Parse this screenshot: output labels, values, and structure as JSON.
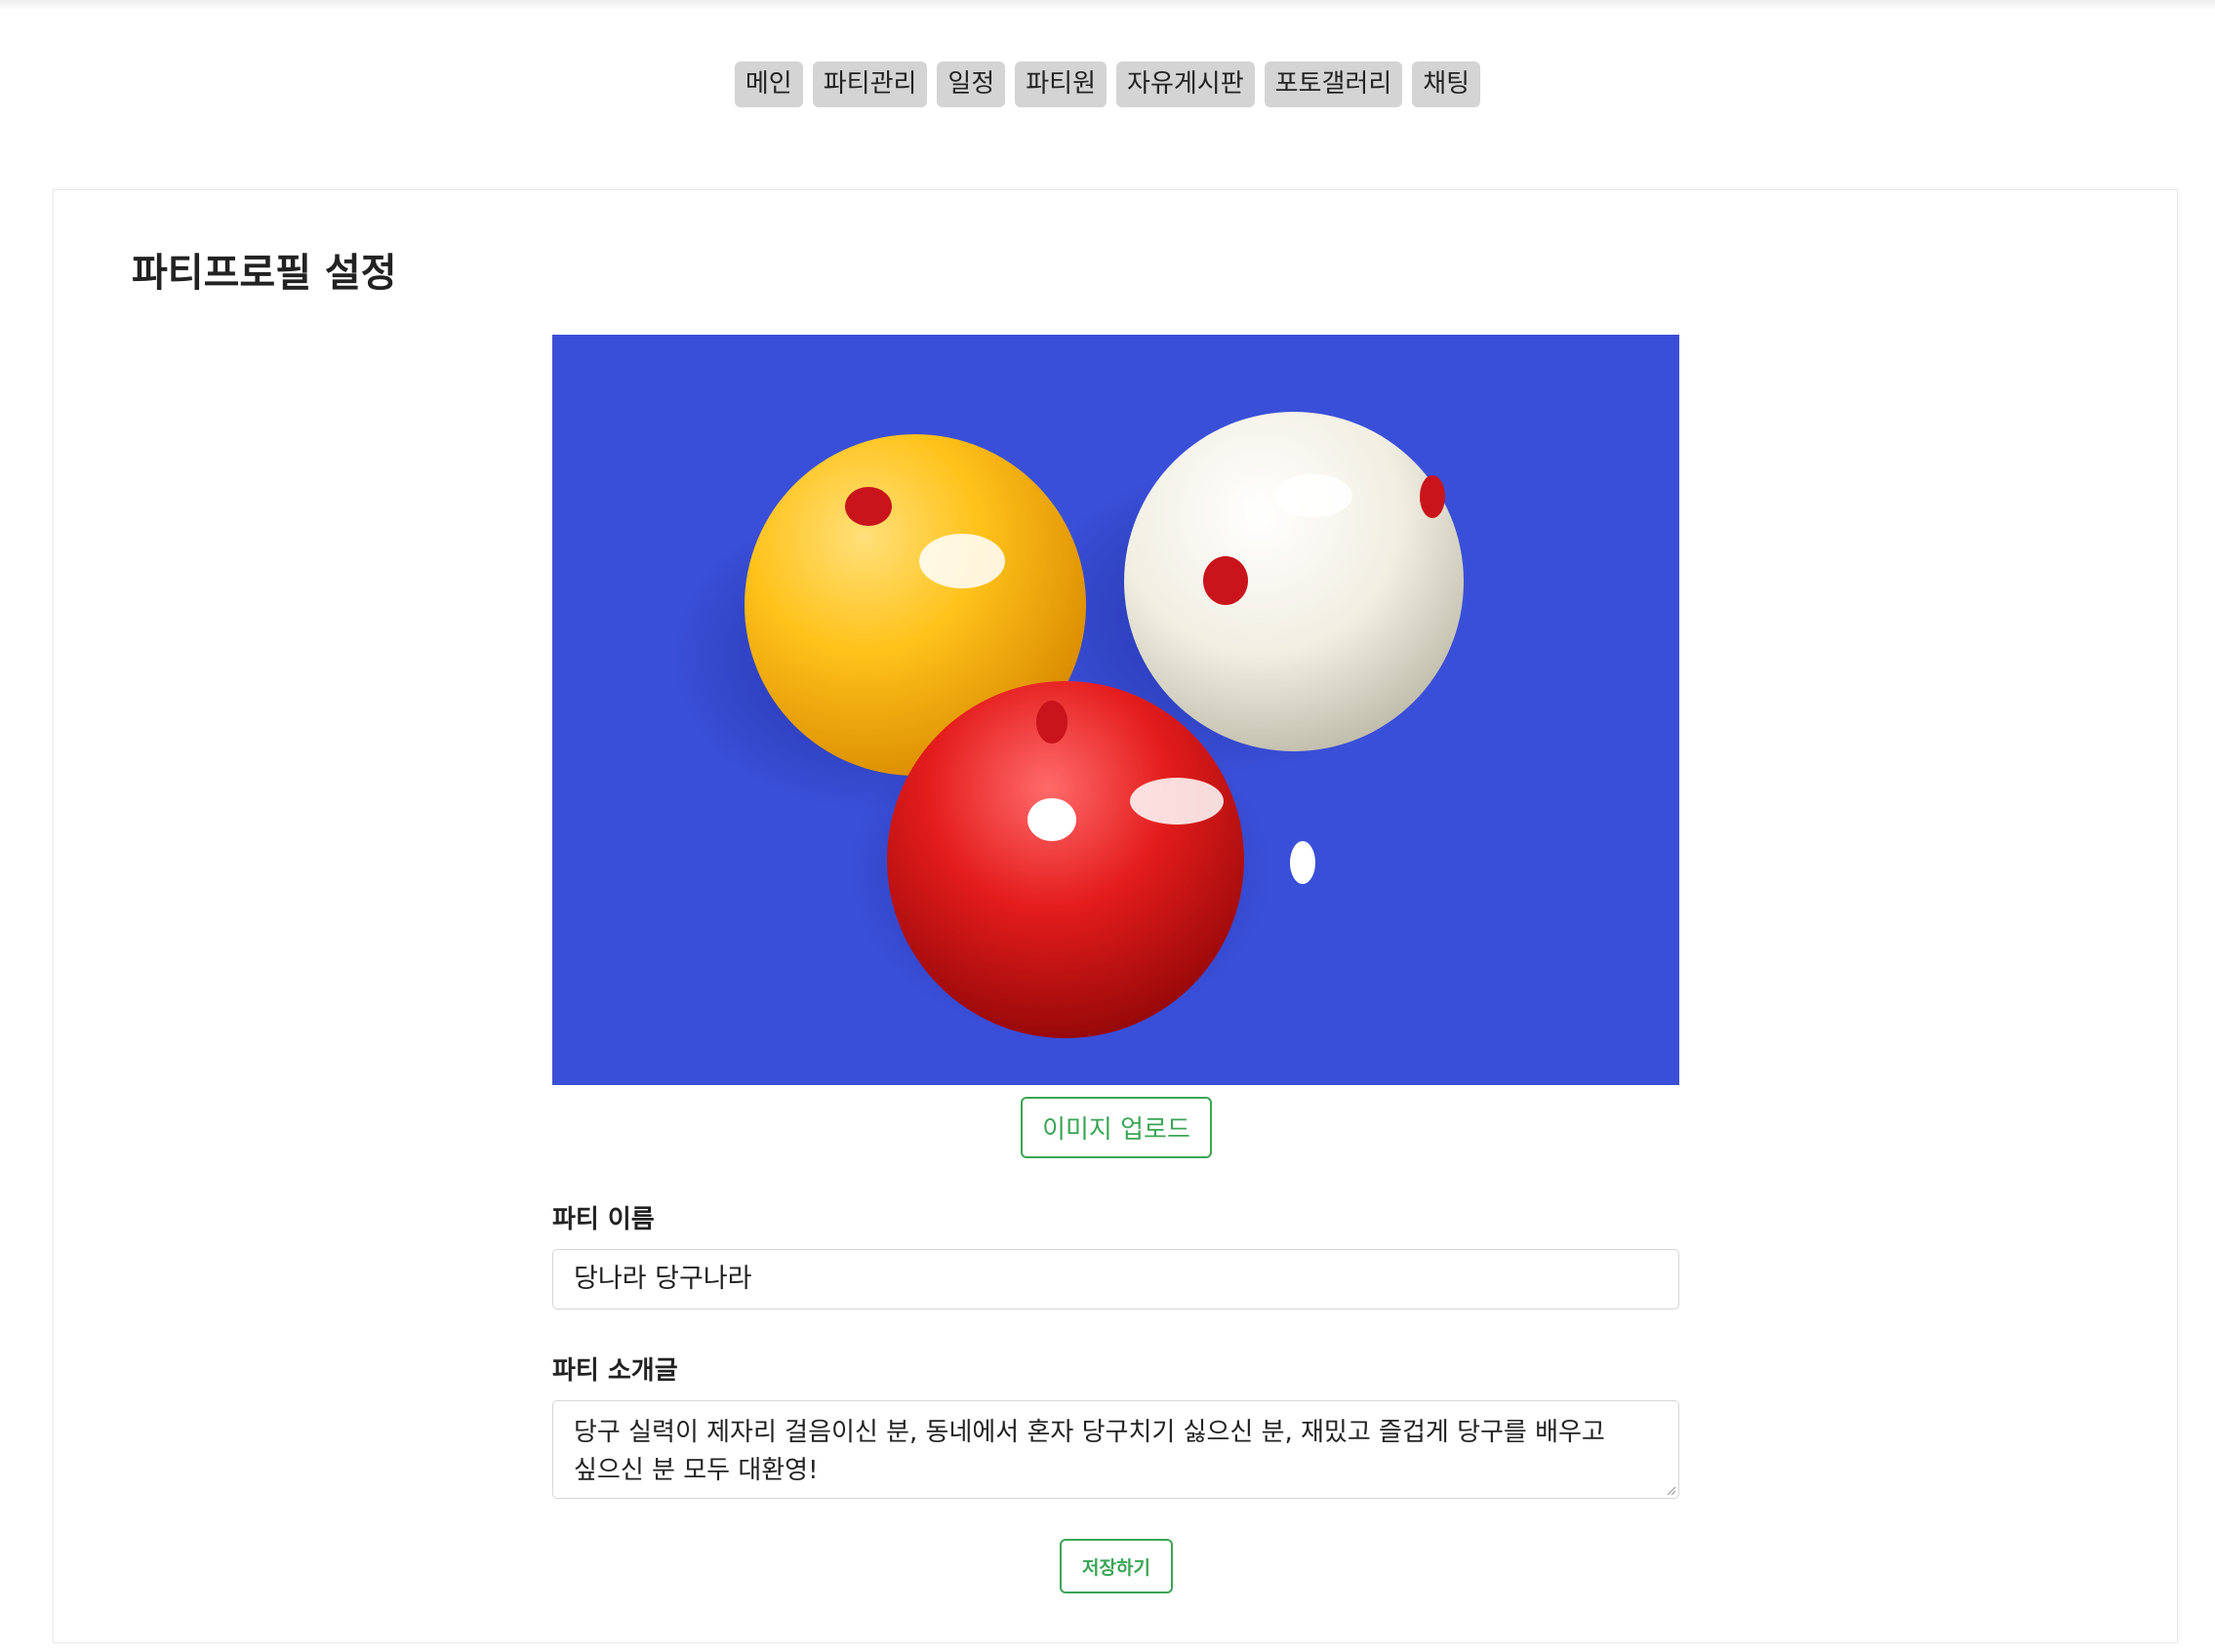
{
  "nav": {
    "items": [
      {
        "label": "메인"
      },
      {
        "label": "파티관리"
      },
      {
        "label": "일정"
      },
      {
        "label": "파티원"
      },
      {
        "label": "자유게시판"
      },
      {
        "label": "포토갤러리"
      },
      {
        "label": "채팅"
      }
    ]
  },
  "page": {
    "title": "파티프로필 설정"
  },
  "profile": {
    "image_icon": "billiard-balls-photo",
    "upload_label": "이미지 업로드",
    "name_label": "파티 이름",
    "name_value": "당나라 당구나라",
    "desc_label": "파티 소개글",
    "desc_value": "당구 실력이 제자리 걸음이신 분, 동네에서 혼자 당구치기 싫으신 분, 재밌고 즐겁게 당구를 배우고 싶으신 분 모두 대환영!",
    "save_label": "저장하기"
  },
  "colors": {
    "accent": "#3aa655",
    "nav_bg": "#d4d4d4",
    "photo_bg": "#3a4fd8"
  }
}
